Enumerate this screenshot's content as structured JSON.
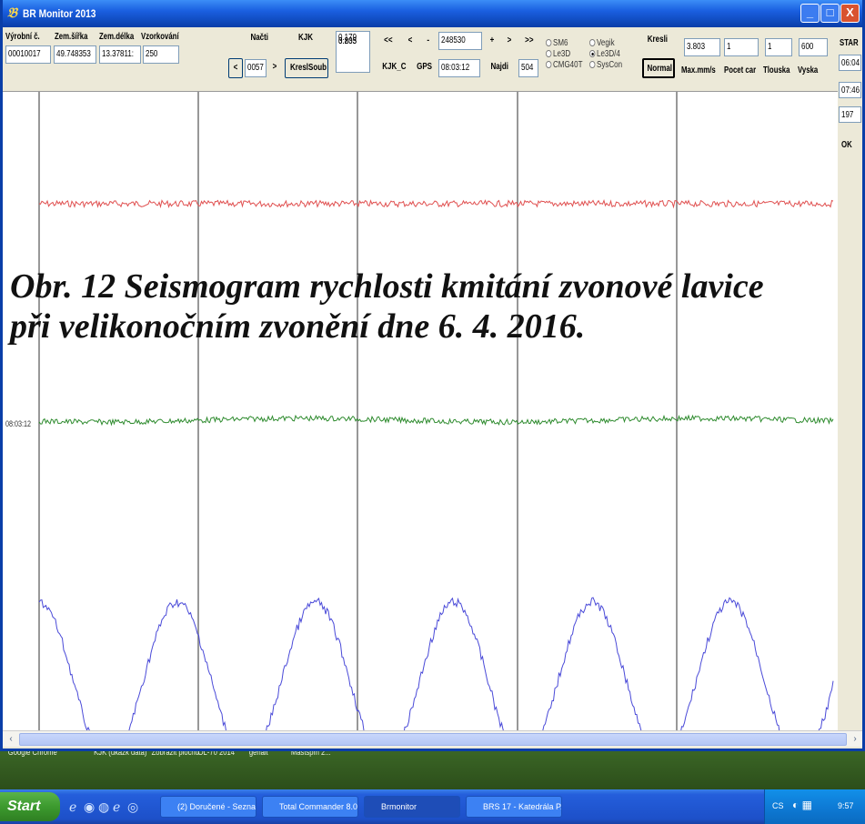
{
  "window": {
    "title": "BR Monitor 2013",
    "controls": {
      "minimize": "_",
      "maximize": "□",
      "close": "X"
    }
  },
  "toolbar": {
    "labels": {
      "vyrobni": "Výrobní č.",
      "sirka": "Zem.šířka",
      "delka": "Zem.délka",
      "vzorkovani": "Vzorkování",
      "maxmm": "Max.mm/s",
      "pocetcar": "Pocet car",
      "tlouska": "Tlouska",
      "vyska": "Vyska",
      "start": "STAR"
    },
    "values": {
      "vyrobni": "00010017",
      "sirka": "49.748353",
      "delka": "13.37811:",
      "vzorkovani": "250",
      "file_num": "0057",
      "readout1": "0.179",
      "readout2": "0.235",
      "readout3": "3.803",
      "counter": "248530",
      "gps_time": "08:03:12",
      "najdi_val": "504",
      "maxmm": "3.803",
      "pocetcar": "1",
      "tlouska": "1",
      "vyska": "600",
      "start_time": "06:04",
      "end_time": "07:46",
      "side_val": "197",
      "ok": "OK"
    },
    "buttons": {
      "nacti": "Načti",
      "kjk": "KJK",
      "prev": "<",
      "next": ">",
      "kreslsoub": "KreslSoub",
      "rewind": "<<",
      "back": "<",
      "minus": "-",
      "plus": "+",
      "fwd": ">",
      "ffwd": ">>",
      "kjk_c": "KJK_C",
      "gps": "GPS",
      "najdi": "Najdi",
      "kresli": "Kresli",
      "normal": "Normal"
    },
    "radios": [
      {
        "label": "SM6",
        "checked": false
      },
      {
        "label": "Vegik",
        "checked": false
      },
      {
        "label": "Le3D",
        "checked": false
      },
      {
        "label": "Le3D/4",
        "checked": true
      },
      {
        "label": "CMG40T",
        "checked": false
      },
      {
        "label": "SysCon",
        "checked": false
      }
    ]
  },
  "plot": {
    "caption_line1": "Obr. 12 Seismogram rychlosti kmitání zvonové lavice",
    "caption_line2": "při velikonočním zvonění dne 6. 4. 2016.",
    "time_marker": "08:03:12",
    "channel_colors": {
      "red": "#e05050",
      "green": "#2e8b2e",
      "blue": "#4a4ad8"
    }
  },
  "desktop_icons": [
    {
      "label": "Google\nChrome"
    },
    {
      "label": "KJK (ukázk\ndata)"
    },
    {
      "label": "Zobrazit\nplochu"
    },
    {
      "label": "OL-70 2014"
    },
    {
      "label": "gehalt"
    },
    {
      "label": "Mastšpm 2..."
    }
  ],
  "taskbar": {
    "start": "Start",
    "tasks": [
      {
        "label": "(2) Doručené - Sezna..."
      },
      {
        "label": "Total Commander 8.0..."
      },
      {
        "label": "Brmonitor"
      },
      {
        "label": "BRS 17 - Katedrála P..."
      }
    ],
    "lang": "CS",
    "clock": "9:57"
  }
}
